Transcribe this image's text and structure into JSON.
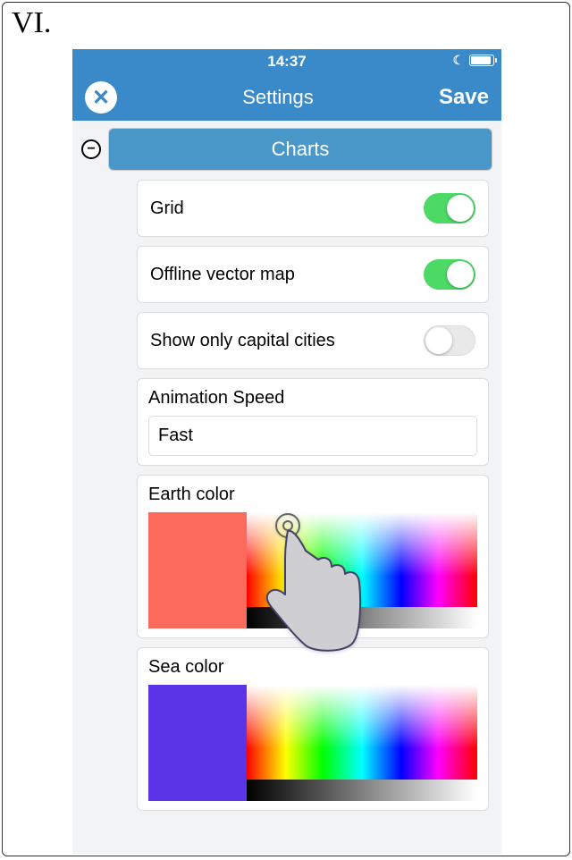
{
  "figure_label": "VI.",
  "statusbar": {
    "time": "14:37",
    "moon_icon": "moon-icon",
    "battery_icon": "battery-icon"
  },
  "navbar": {
    "close_icon": "close-icon",
    "title": "Settings",
    "save_label": "Save"
  },
  "section": {
    "collapse_icon": "minus-circle-icon",
    "title": "Charts"
  },
  "settings": {
    "grid": {
      "label": "Grid",
      "value": true
    },
    "offline_map": {
      "label": "Offline vector map",
      "value": true
    },
    "capital_cities": {
      "label": "Show only capital cities",
      "value": false
    },
    "animation_speed": {
      "label": "Animation Speed",
      "value": "Fast"
    },
    "earth_color": {
      "label": "Earth color",
      "value": "#fb6b5b"
    },
    "sea_color": {
      "label": "Sea color",
      "value": "#5a34e6"
    }
  },
  "pointer": {
    "kind": "hand-pointer",
    "interpretation": "user tapping earth-color spectrum"
  }
}
